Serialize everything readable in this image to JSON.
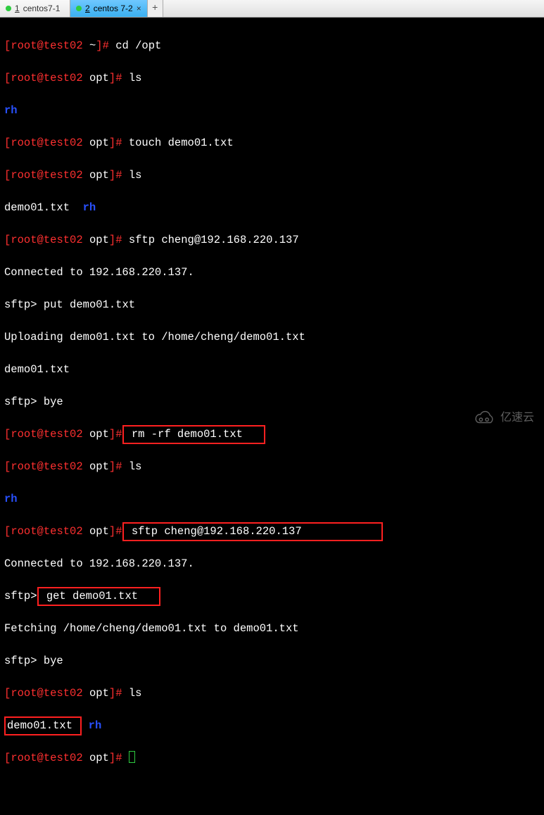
{
  "tabs": {
    "items": [
      {
        "num": "1",
        "label": "centos7-1",
        "close_visible": false
      },
      {
        "num": "2",
        "label": "centos 7-2",
        "close_visible": true
      }
    ],
    "active_index": 1,
    "add_symbol": "+",
    "close_symbol": "×"
  },
  "terminal": {
    "prompt_user": "root",
    "prompt_host": "test02",
    "sftp_prompt": "sftp>",
    "rh_text": "rh",
    "lines": [
      {
        "path": "~",
        "cmd": "cd /opt"
      },
      {
        "path": "opt",
        "cmd": "ls"
      }
    ],
    "output_rh1": "rh",
    "lines2": [
      {
        "path": "opt",
        "cmd": "touch demo01.txt"
      },
      {
        "path": "opt",
        "cmd": "ls"
      }
    ],
    "output_ls1_a": "demo01.txt",
    "output_ls1_b": "rh",
    "line_sftp1": {
      "path": "opt",
      "cmd": "sftp cheng@192.168.220.137"
    },
    "conn1": "Connected to 192.168.220.137.",
    "put_cmd": "put demo01.txt",
    "uploading": "Uploading demo01.txt to /home/cheng/demo01.txt",
    "put_file": "demo01.txt",
    "bye1": "bye",
    "line_rm": {
      "path": "opt",
      "pre": "",
      "boxcmd": "rm -rf demo01.txt"
    },
    "line_ls3": {
      "path": "opt",
      "cmd": "ls"
    },
    "output_rh2": "rh",
    "line_sftp2": {
      "path": "opt",
      "boxcmd": "sftp cheng@192.168.220.137"
    },
    "conn2": "Connected to 192.168.220.137.",
    "get_cmd": "get demo01.txt",
    "fetching": "Fetching /home/cheng/demo01.txt to demo01.txt",
    "bye2": "bye",
    "line_ls4": {
      "path": "opt",
      "cmd": "ls"
    },
    "output_ls4_a": "demo01.txt ",
    "output_ls4_b": "rh",
    "line_final": {
      "path": "opt"
    }
  },
  "watermark": {
    "text": "亿速云"
  }
}
